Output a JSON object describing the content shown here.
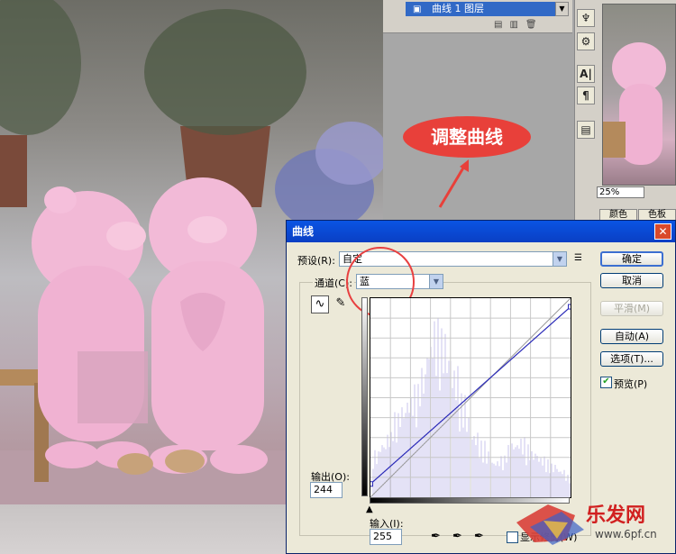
{
  "layers_panel": {
    "layer_name": "曲线 1 图层"
  },
  "toolstrip": {
    "icons": [
      "brush-tool-icon",
      "stamp-tool-icon",
      "type-A-icon",
      "paragraph-icon",
      "notes-icon"
    ],
    "labels": [
      "A|",
      "¶"
    ]
  },
  "navigator": {
    "zoom": "25%",
    "tabs": [
      "颜色",
      "色板"
    ]
  },
  "annotation": {
    "text": "调整曲线"
  },
  "dialog": {
    "title": "曲线",
    "preset_label": "预设(R):",
    "preset_value": "自定",
    "channel_label": "通道(C):",
    "channel_value": "蓝",
    "output_label": "输出(O):",
    "output_value": "244",
    "input_label": "输入(I):",
    "input_value": "255",
    "buttons": {
      "ok": "确定",
      "cancel": "取消",
      "smooth": "平滑(M)",
      "auto": "自动(A)",
      "options": "选项(T)..."
    },
    "preview_label": "预览(P)",
    "preview_checked": true,
    "bottom_checkbox_label": "显示修剪(W)",
    "curve_points": [
      [
        0,
        17
      ],
      [
        255,
        244
      ]
    ]
  },
  "watermark": {
    "site": "乐发网",
    "url": "www.6pf.cn"
  },
  "colors": {
    "accent": "#e8403a",
    "title_blue": "#0a54e3",
    "curve": "#2a2ab8"
  }
}
